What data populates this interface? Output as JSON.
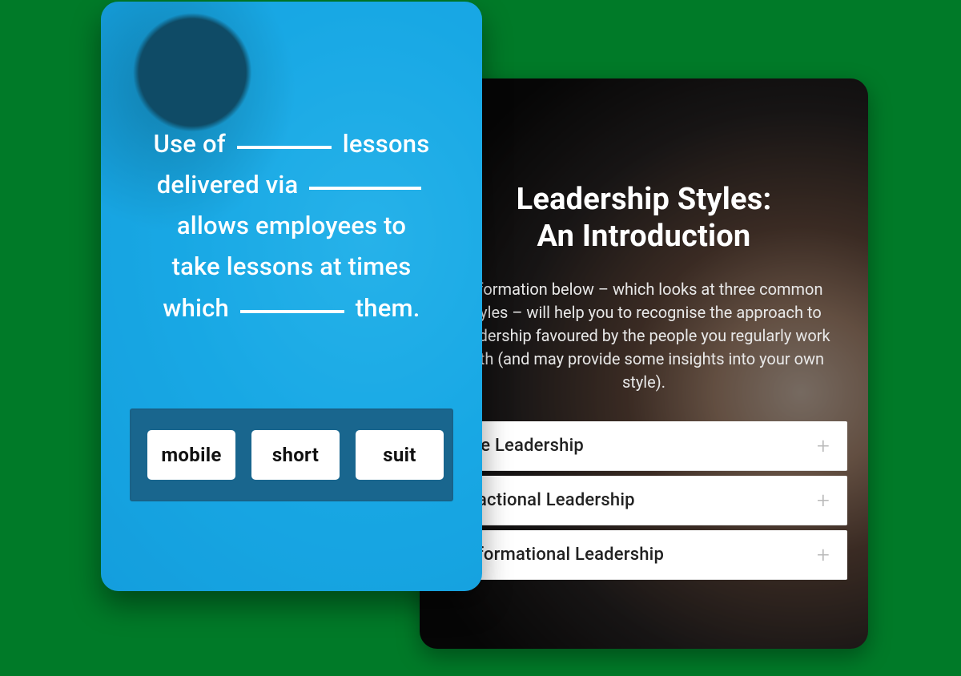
{
  "back_card": {
    "title_line1": "Leadership Styles:",
    "title_line2": "An Introduction",
    "description": "information below – which looks at three common styles – will help you to recognise the approach to leadership favoured by the people you regularly work with (and may provide some insights into your own style).",
    "items": [
      {
        "label": "sive Leadership"
      },
      {
        "label": "nsactional Leadership"
      },
      {
        "label": "nsformational Leadership"
      }
    ]
  },
  "front_card": {
    "prompt_parts": {
      "p1": "Use of",
      "p2": "lessons",
      "p3": "delivered via",
      "p4": "allows employees to",
      "p5": "take lessons at times",
      "p6": "which",
      "p7": "them."
    },
    "options": [
      {
        "label": "mobile"
      },
      {
        "label": "short"
      },
      {
        "label": "suit"
      }
    ]
  }
}
